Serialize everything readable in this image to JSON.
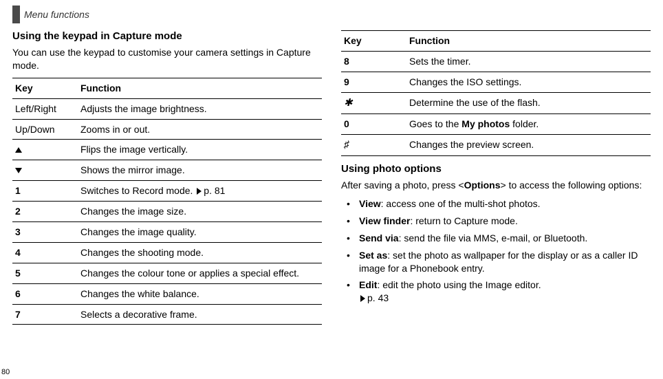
{
  "header": {
    "title": "Menu functions"
  },
  "page_number": "80",
  "left": {
    "heading": "Using the keypad in Capture mode",
    "intro": "You can use the keypad to customise your camera settings in Capture mode.",
    "table": {
      "head_key": "Key",
      "head_func": "Function",
      "rows": [
        {
          "key": "Left/Right",
          "bold": false,
          "func": "Adjusts the image brightness.",
          "icon": ""
        },
        {
          "key": "Up/Down",
          "bold": false,
          "func": "Zooms in or out.",
          "icon": ""
        },
        {
          "key": "",
          "bold": false,
          "func": "Flips the image vertically.",
          "icon": "tri-up"
        },
        {
          "key": "",
          "bold": false,
          "func": "Shows the mirror image.",
          "icon": "tri-down"
        },
        {
          "key": "1",
          "bold": true,
          "func": "Switches to Record mode.",
          "icon": "",
          "link": "p. 81"
        },
        {
          "key": "2",
          "bold": true,
          "func": "Changes the image size.",
          "icon": ""
        },
        {
          "key": "3",
          "bold": true,
          "func": "Changes the image quality.",
          "icon": ""
        },
        {
          "key": "4",
          "bold": true,
          "func": "Changes the shooting mode.",
          "icon": ""
        },
        {
          "key": "5",
          "bold": true,
          "func": "Changes the colour tone or applies a special effect.",
          "icon": ""
        },
        {
          "key": "6",
          "bold": true,
          "func": "Changes the white balance.",
          "icon": ""
        },
        {
          "key": "7",
          "bold": true,
          "func": "Selects a decorative frame.",
          "icon": ""
        }
      ]
    }
  },
  "right": {
    "table": {
      "head_key": "Key",
      "head_func": "Function",
      "rows": [
        {
          "key": "8",
          "bold": true,
          "func": "Sets the timer."
        },
        {
          "key": "9",
          "bold": true,
          "func": "Changes the ISO settings."
        },
        {
          "key": "✱",
          "bold": false,
          "class": "asterisk-key",
          "func": "Determine the use of the flash."
        },
        {
          "key": "0",
          "bold": true,
          "func_pre": "Goes to the ",
          "func_bold": "My photos",
          "func_post": " folder."
        },
        {
          "key": "♯",
          "bold": false,
          "class": "hash-key",
          "func": "Changes the preview screen."
        }
      ]
    },
    "heading2": "Using photo options",
    "intro2_pre": "After saving a photo, press <",
    "intro2_bold": "Options",
    "intro2_post": "> to access the following options:",
    "bullets": [
      {
        "term": "View",
        "rest": ": access one of the multi-shot photos."
      },
      {
        "term": "View finder",
        "rest": ": return to Capture mode."
      },
      {
        "term": "Send via",
        "rest": ": send the file via MMS, e-mail, or Bluetooth."
      },
      {
        "term": "Set as",
        "rest": ": set the photo as wallpaper for the display or as a caller ID image for a Phonebook entry."
      },
      {
        "term": "Edit",
        "rest": ": edit the photo using the Image editor.",
        "link": "p. 43"
      }
    ]
  }
}
